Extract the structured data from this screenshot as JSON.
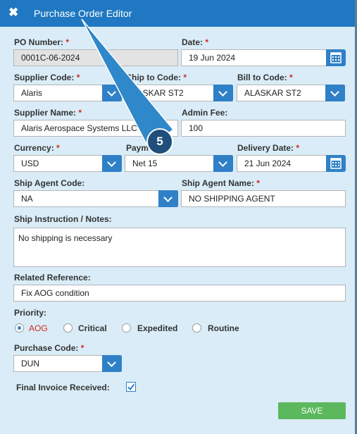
{
  "window": {
    "title": "Purchase Order Editor"
  },
  "labels": {
    "po_number": "PO Number:",
    "date": "Date:",
    "supplier_code": "Supplier Code:",
    "ship_to_code": "Ship to Code:",
    "bill_to_code": "Bill to Code:",
    "supplier_name": "Supplier Name:",
    "admin_fee": "Admin Fee:",
    "currency": "Currency:",
    "payment": "Paym",
    "delivery_date": "Delivery Date:",
    "ship_agent_code": "Ship Agent Code:",
    "ship_agent_name": "Ship Agent Name:",
    "ship_instruction": "Ship Instruction / Notes:",
    "related_reference": "Related Reference:",
    "priority": "Priority:",
    "purchase_code": "Purchase Code:",
    "final_invoice": "Final Invoice Received:",
    "required_mark": "*"
  },
  "values": {
    "po_number": "0001C-06-2024",
    "date": "19 Jun 2024",
    "supplier_code": "Alaris",
    "ship_to_code": "LASKAR ST2",
    "bill_to_code": "ALASKAR ST2",
    "supplier_name": "Alaris Aerospace Systems LLC",
    "admin_fee": "100",
    "currency": "USD",
    "payment": "Net 15",
    "delivery_date": "21 Jun 2024",
    "ship_agent_code": "NA",
    "ship_agent_name": "NO SHIPPING AGENT",
    "ship_instruction": "No shipping is necessary",
    "related_reference": "Fix AOG condition",
    "purchase_code": "DUN"
  },
  "priority_options": [
    "AOG",
    "Critical",
    "Expedited",
    "Routine"
  ],
  "priority_selected": "AOG",
  "final_invoice_checked": true,
  "buttons": {
    "save": "SAVE"
  },
  "annotation": {
    "step": "5"
  },
  "colors": {
    "header": "#1f78c1",
    "panel": "#d9ecf8",
    "accent": "#2f80c7",
    "save": "#5cb85c",
    "required": "#d6281c"
  }
}
